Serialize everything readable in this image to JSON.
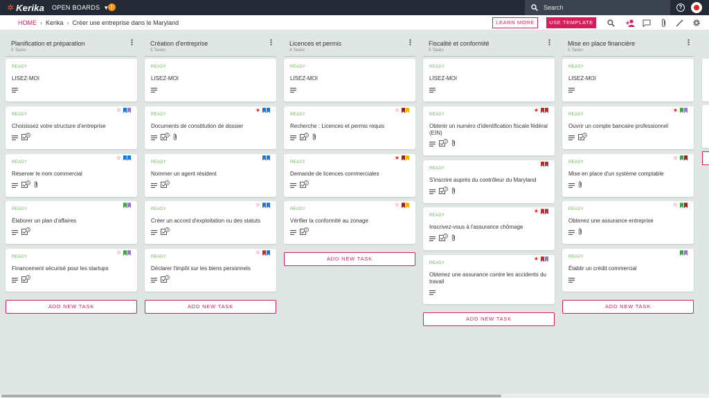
{
  "app": {
    "logo_text": "Kerika",
    "open_boards": "OPEN BOARDS",
    "badge": "!"
  },
  "search": {
    "label": "Search"
  },
  "breadcrumb": {
    "home": "HOME",
    "kerika": "Kerika",
    "board": "Créer une entreprise dans le Maryland"
  },
  "buttons": {
    "learn_more": "LEARN MORE",
    "use_template": "USE TEMPLATE",
    "add_task": "ADD NEW TASK"
  },
  "colors": {
    "accent": "#d51c5c",
    "topbar": "#232a35",
    "board_bg": "#dfe6e3",
    "ready": "#6bb35c",
    "tag_blue": "#1976d2",
    "tag_purple": "#9575cd",
    "tag_green": "#43a047",
    "tag_red": "#c62828",
    "tag_yellow": "#f4b400",
    "tag_darkred": "#8e2424"
  },
  "columns": [
    {
      "title": "Planification et préparation",
      "count": "5 Tasks",
      "cards": [
        {
          "status": "READY",
          "title": "LISEZ-MOI",
          "star": "none",
          "tags": [],
          "icons": [
            "desc"
          ]
        },
        {
          "status": "READY",
          "title": "Choisissez votre structure d'entreprise",
          "star": "off",
          "tags": [
            "blue",
            "purple"
          ],
          "icons": [
            "desc",
            "check"
          ],
          "check_count": "6"
        },
        {
          "status": "READY",
          "title": "Réserver le nom commercial",
          "star": "off",
          "tags": [
            "blue",
            "blue"
          ],
          "icons": [
            "desc",
            "check",
            "attach"
          ],
          "check_count": "4"
        },
        {
          "status": "READY",
          "title": "Élaborer un plan d'affaires",
          "star": "none",
          "tags": [
            "green",
            "purple"
          ],
          "icons": [
            "desc",
            "check"
          ],
          "check_count": "3"
        },
        {
          "status": "READY",
          "title": "Financement sécurisé pour les startups",
          "star": "off",
          "tags": [
            "green",
            "purple"
          ],
          "icons": [
            "desc",
            "check"
          ],
          "check_count": "3"
        }
      ]
    },
    {
      "title": "Création d'entreprise",
      "count": "5 Tasks",
      "cards": [
        {
          "status": "READY",
          "title": "LISEZ-MOI",
          "star": "none",
          "tags": [],
          "icons": [
            "desc"
          ]
        },
        {
          "status": "READY",
          "title": "Documents de constitution de dossier",
          "star": "on",
          "tags": [
            "blue",
            "blue"
          ],
          "icons": [
            "desc",
            "check",
            "attach"
          ],
          "check_count": "5"
        },
        {
          "status": "READY",
          "title": "Nommer un agent résident",
          "star": "none",
          "tags": [
            "blue",
            "blue"
          ],
          "icons": [
            "desc",
            "check"
          ],
          "check_count": "2"
        },
        {
          "status": "READY",
          "title": "Créer un accord d'exploitation ou des statuts",
          "star": "off",
          "tags": [
            "blue",
            "blue"
          ],
          "icons": [
            "desc",
            "check"
          ],
          "check_count": "3"
        },
        {
          "status": "READY",
          "title": "Déclarer l'impôt sur les biens personnels",
          "star": "off",
          "tags": [
            "red",
            "blue"
          ],
          "icons": [
            "desc",
            "check"
          ],
          "check_count": "3"
        }
      ]
    },
    {
      "title": "Licences et permis",
      "count": "4 Tasks",
      "cards": [
        {
          "status": "READY",
          "title": "LISEZ-MOI",
          "star": "none",
          "tags": [],
          "icons": [
            "desc"
          ]
        },
        {
          "status": "READY",
          "title": "Recherche : Licences et permis requis",
          "star": "off",
          "tags": [
            "darkred",
            "yellow"
          ],
          "icons": [
            "desc",
            "check",
            "attach"
          ],
          "check_count": "5"
        },
        {
          "status": "READY",
          "title": "Demande de licences commerciales",
          "star": "on",
          "tags": [
            "darkred",
            "yellow"
          ],
          "icons": [
            "desc",
            "check"
          ],
          "check_count": "2"
        },
        {
          "status": "READY",
          "title": "Vérifier la conformité au zonage",
          "star": "off",
          "tags": [
            "darkred",
            "yellow"
          ],
          "icons": [
            "desc",
            "check"
          ],
          "check_count": "2"
        }
      ]
    },
    {
      "title": "Fiscalité et conformité",
      "count": "5 Tasks",
      "cards": [
        {
          "status": "READY",
          "title": "LISEZ-MOI",
          "star": "none",
          "tags": [],
          "icons": [
            "desc"
          ]
        },
        {
          "status": "READY",
          "title": "Obtenir un numéro d'identification fiscale fédéral (EIN)",
          "star": "on",
          "tags": [
            "red",
            "red"
          ],
          "icons": [
            "desc",
            "check",
            "attach"
          ],
          "check_count": "3"
        },
        {
          "status": "READY",
          "title": "S'inscrire auprès du contrôleur du Maryland",
          "star": "none",
          "tags": [
            "red",
            "red"
          ],
          "icons": [
            "desc",
            "check",
            "attach"
          ],
          "check_count": "3"
        },
        {
          "status": "READY",
          "title": "Inscrivez-vous à l'assurance chômage",
          "star": "on",
          "tags": [
            "red",
            "red"
          ],
          "icons": [
            "desc",
            "check",
            "attach"
          ],
          "check_count": "3"
        },
        {
          "status": "READY",
          "title": "Obtenez une assurance contre les accidents du travail",
          "star": "on",
          "tags": [
            "red",
            "purple"
          ],
          "icons": [
            "desc"
          ]
        }
      ]
    },
    {
      "title": "Mise en place financière",
      "count": "5 Tasks",
      "cards": [
        {
          "status": "READY",
          "title": "LISEZ-MOI",
          "star": "none",
          "tags": [],
          "icons": [
            "desc"
          ]
        },
        {
          "status": "READY",
          "title": "Ouvrir un compte bancaire professionnel",
          "star": "on",
          "tags": [
            "green",
            "purple"
          ],
          "icons": [
            "desc",
            "check"
          ],
          "check_count": "3"
        },
        {
          "status": "READY",
          "title": "Mise en place d'un système comptable",
          "star": "off",
          "tags": [
            "green",
            "darkred"
          ],
          "icons": [
            "desc",
            "attach"
          ]
        },
        {
          "status": "READY",
          "title": "Obtenez une assurance entreprise",
          "star": "off",
          "tags": [
            "green",
            "darkred"
          ],
          "icons": [
            "desc",
            "attach"
          ]
        },
        {
          "status": "READY",
          "title": "Établir un crédit commercial",
          "star": "none",
          "tags": [
            "green",
            "purple"
          ],
          "icons": [
            "desc"
          ]
        }
      ]
    }
  ]
}
